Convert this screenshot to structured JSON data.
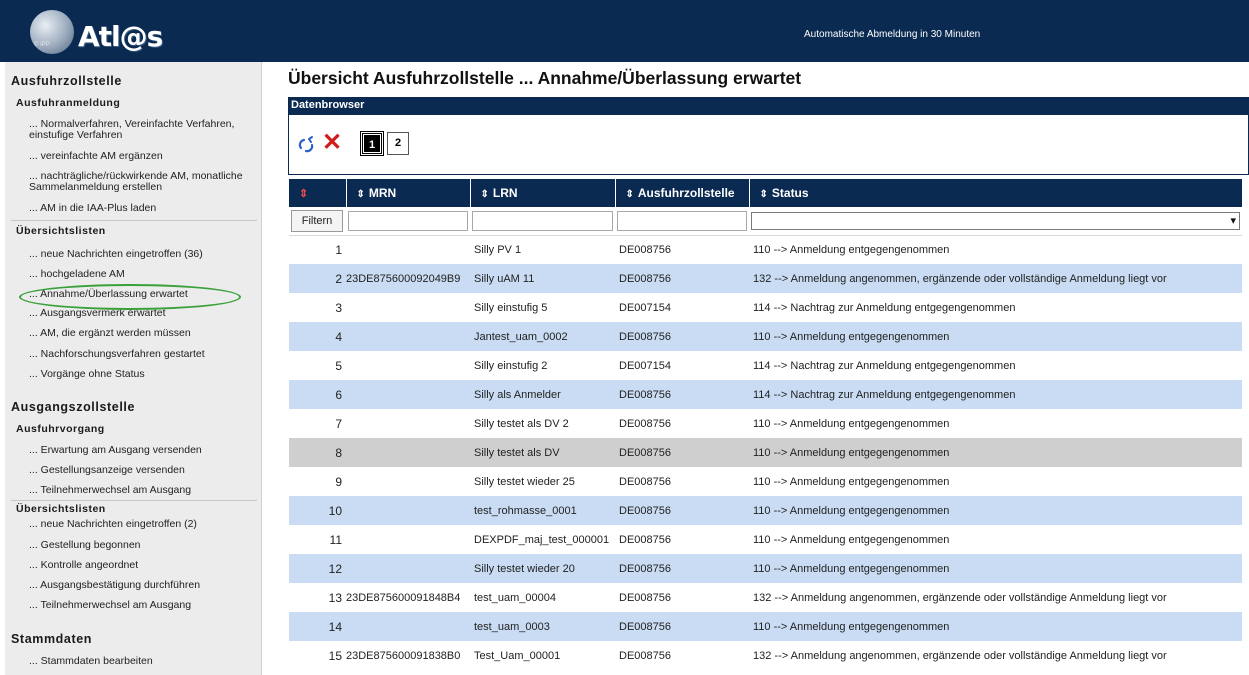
{
  "header": {
    "logo_text": "Atl@s",
    "logo_small": "© IPP",
    "logout_note": "Automatische Abmeldung in 30 Minuten"
  },
  "sidebar": {
    "sections": [
      {
        "title": "Ausfuhrzollstelle",
        "subtitle": "Ausfuhranmeldung",
        "items": [
          "... Normalverfahren, Vereinfachte Verfahren, einstufige Verfahren",
          "... vereinfachte AM ergänzen",
          "... nachträgliche/rückwirkende AM, monatliche Sammelanmeldung erstellen",
          "... AM in die IAA-Plus laden"
        ],
        "list_title": "Übersichtslisten",
        "list_items": [
          "... neue Nachrichten eingetroffen (36)",
          "... hochgeladene AM",
          "... Annahme/Überlassung erwartet",
          "... Ausgangsvermerk erwartet",
          "... AM, die ergänzt werden müssen",
          "... Nachforschungsverfahren gestartet",
          "... Vorgänge ohne Status"
        ]
      },
      {
        "title": "Ausgangszollstelle",
        "subtitle": "Ausfuhrvorgang",
        "items": [
          "... Erwartung am Ausgang versenden",
          "... Gestellungsanzeige versenden",
          "... Teilnehmerwechsel am Ausgang"
        ],
        "list_title": "Übersichtslisten",
        "list_items": [
          "... neue Nachrichten eingetroffen (2)",
          "... Gestellung begonnen",
          "... Kontrolle angeordnet",
          "... Ausgangsbestätigung durchführen",
          "... Teilnehmerwechsel am Ausgang"
        ]
      },
      {
        "title": "Stammdaten",
        "items": [
          "... Stammdaten bearbeiten"
        ]
      }
    ]
  },
  "main": {
    "title": "Übersicht Ausfuhrzollstelle ... Annahme/Überlassung erwartet",
    "browser_label": "Datenbrowser",
    "pages": [
      "1",
      "2"
    ],
    "active_page": "1",
    "filter_button": "Filtern",
    "columns": [
      "MRN",
      "LRN",
      "Ausfuhrzollstelle",
      "Status"
    ],
    "sort_symbol": "⇕",
    "rows": [
      {
        "n": "1",
        "mrn": "",
        "lrn": "Silly PV 1",
        "office": "DE008756",
        "status": "110 --> Anmeldung entgegengenommen",
        "style": "white"
      },
      {
        "n": "2",
        "mrn": "23DE875600092049B9",
        "lrn": "Silly uAM 11",
        "office": "DE008756",
        "status": "132 --> Anmeldung angenommen, ergänzende oder vollständige Anmeldung liegt vor",
        "style": "blue"
      },
      {
        "n": "3",
        "mrn": "",
        "lrn": "Silly einstufig 5",
        "office": "DE007154",
        "status": "114 --> Nachtrag zur Anmeldung entgegengenommen",
        "style": "white"
      },
      {
        "n": "4",
        "mrn": "",
        "lrn": "Jantest_uam_0002",
        "office": "DE008756",
        "status": "110 --> Anmeldung entgegengenommen",
        "style": "blue"
      },
      {
        "n": "5",
        "mrn": "",
        "lrn": "Silly einstufig 2",
        "office": "DE007154",
        "status": "114 --> Nachtrag zur Anmeldung entgegengenommen",
        "style": "white"
      },
      {
        "n": "6",
        "mrn": "",
        "lrn": "Silly als Anmelder",
        "office": "DE008756",
        "status": "114 --> Nachtrag zur Anmeldung entgegengenommen",
        "style": "blue"
      },
      {
        "n": "7",
        "mrn": "",
        "lrn": "Silly testet als DV 2",
        "office": "DE008756",
        "status": "110 --> Anmeldung entgegengenommen",
        "style": "white"
      },
      {
        "n": "8",
        "mrn": "",
        "lrn": "Silly testet als DV",
        "office": "DE008756",
        "status": "110 --> Anmeldung entgegengenommen",
        "style": "gray"
      },
      {
        "n": "9",
        "mrn": "",
        "lrn": "Silly testet wieder 25",
        "office": "DE008756",
        "status": "110 --> Anmeldung entgegengenommen",
        "style": "white"
      },
      {
        "n": "10",
        "mrn": "",
        "lrn": "test_rohmasse_0001",
        "office": "DE008756",
        "status": "110 --> Anmeldung entgegengenommen",
        "style": "blue"
      },
      {
        "n": "11",
        "mrn": "",
        "lrn": "DEXPDF_maj_test_000001",
        "office": "DE008756",
        "status": "110 --> Anmeldung entgegengenommen",
        "style": "white"
      },
      {
        "n": "12",
        "mrn": "",
        "lrn": "Silly testet wieder 20",
        "office": "DE008756",
        "status": "110 --> Anmeldung entgegengenommen",
        "style": "blue"
      },
      {
        "n": "13",
        "mrn": "23DE875600091848B4",
        "lrn": "test_uam_00004",
        "office": "DE008756",
        "status": "132 --> Anmeldung angenommen, ergänzende oder vollständige Anmeldung liegt vor",
        "style": "white"
      },
      {
        "n": "14",
        "mrn": "",
        "lrn": "test_uam_0003",
        "office": "DE008756",
        "status": "110 --> Anmeldung entgegengenommen",
        "style": "blue"
      },
      {
        "n": "15",
        "mrn": "23DE875600091838B0",
        "lrn": "Test_Uam_00001",
        "office": "DE008756",
        "status": "132 --> Anmeldung angenommen, ergänzende oder vollständige Anmeldung liegt vor",
        "style": "white"
      }
    ]
  },
  "colors": {
    "navy": "#0b2a52",
    "row_blue": "#c9dcf3",
    "row_gray": "#cfcfcf",
    "highlight_green": "#3aa03a",
    "delete_red": "#d21b1b"
  }
}
